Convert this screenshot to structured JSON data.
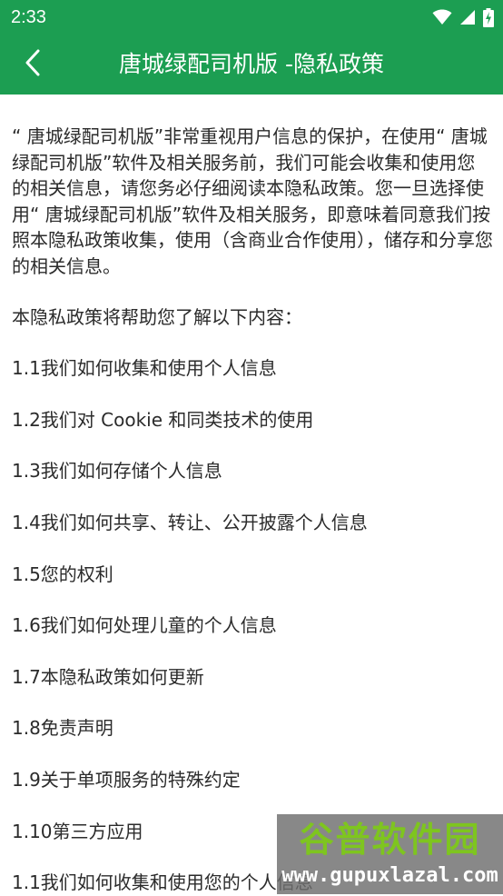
{
  "status_bar": {
    "time": "2:33",
    "icons": [
      "wifi-icon",
      "signal-icon",
      "battery-charging-icon"
    ]
  },
  "app_bar": {
    "back_icon": "chevron-left-icon",
    "title": "唐城绿配司机版 -隐私政策"
  },
  "content": {
    "intro": "“ 唐城绿配司机版”非常重视用户信息的保护，在使用“ 唐城绿配司机版”软件及相关服务前，我们可能会收集和使用您的相关信息，请您务必仔细阅读本隐私政策。您一旦选择使用“ 唐城绿配司机版”软件及相关服务，即意味着同意我们按照本隐私政策收集，使用（含商业合作使用），储存和分享您的相关信息。",
    "subhead": "本隐私政策将帮助您了解以下内容：",
    "toc": [
      "1.1我们如何收集和使用个人信息",
      "1.2我们对 Cookie 和同类技术的使用",
      "1.3我们如何存储个人信息",
      "1.4我们如何共享、转让、公开披露个人信息",
      "1.5您的权利",
      "1.6我们如何处理儿童的个人信息",
      "1.7本隐私政策如何更新",
      "1.8免责声明",
      "1.9关于单项服务的特殊约定",
      "1.10第三方应用",
      "1.1我们如何收集和使用您的个人信息"
    ]
  },
  "watermark": {
    "title": "谷普软件园",
    "url": "www.gupuxlazal.com"
  },
  "colors": {
    "primary": "#1c9e52",
    "text": "#2b2b2b",
    "watermark_green": "#7ec51f"
  }
}
